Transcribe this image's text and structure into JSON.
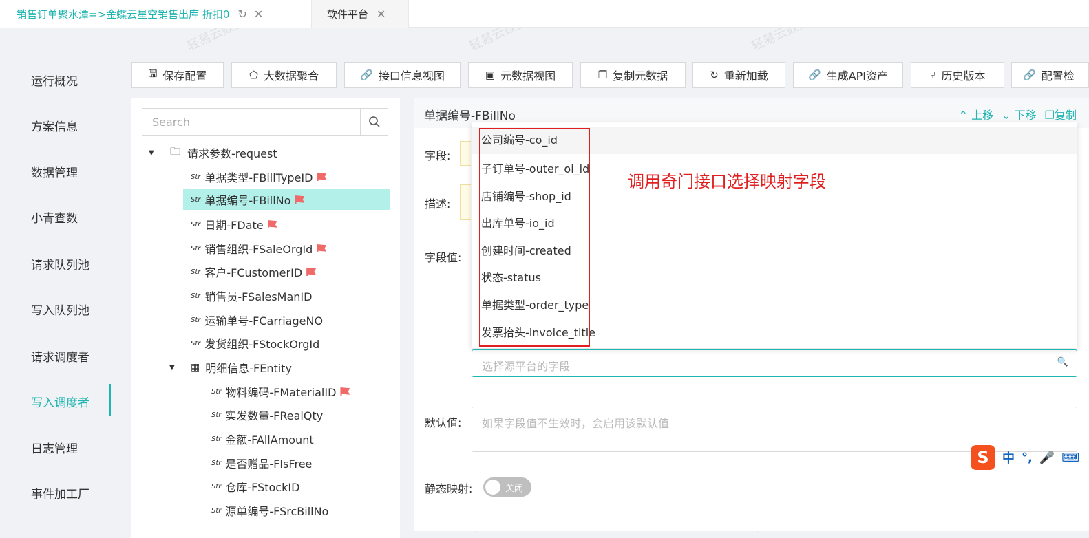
{
  "tabs": [
    {
      "label": "销售订单聚水潭=>金蝶云星空销售出库 折扣0",
      "active": true
    },
    {
      "label": "软件平台",
      "active": false
    }
  ],
  "nav": {
    "items": [
      "运行概况",
      "方案信息",
      "数据管理",
      "小青查数",
      "请求队列池",
      "写入队列池",
      "请求调度者",
      "写入调度者",
      "日志管理",
      "事件加工厂"
    ],
    "active": "写入调度者"
  },
  "toolbar": {
    "buttons": [
      "保存配置",
      "大数据聚合",
      "接口信息视图",
      "元数据视图",
      "复制元数据",
      "重新加载",
      "生成API资产",
      "历史版本",
      "配置检"
    ]
  },
  "tree": {
    "search_placeholder": "Search",
    "root": "请求参数-request",
    "fields": [
      {
        "label": "单据类型-FBillTypeID",
        "flag": true
      },
      {
        "label": "单据编号-FBillNo",
        "flag": true,
        "selected": true
      },
      {
        "label": "日期-FDate",
        "flag": true
      },
      {
        "label": "销售组织-FSaleOrgId",
        "flag": true
      },
      {
        "label": "客户-FCustomerID",
        "flag": true
      },
      {
        "label": "销售员-FSalesManID",
        "flag": false
      },
      {
        "label": "运输单号-FCarriageNO",
        "flag": false
      },
      {
        "label": "发货组织-FStockOrgId",
        "flag": false
      }
    ],
    "entity": "明细信息-FEntity",
    "entity_fields": [
      {
        "label": "物料编码-FMaterialID",
        "flag": true
      },
      {
        "label": "实发数量-FRealQty",
        "flag": false
      },
      {
        "label": "金额-FAllAmount",
        "flag": false
      },
      {
        "label": "是否赠品-FIsFree",
        "flag": false
      },
      {
        "label": "仓库-FStockID",
        "flag": false
      },
      {
        "label": "源单编号-FSrcBillNo",
        "flag": false
      }
    ],
    "str_tag": "Str"
  },
  "detail": {
    "title": "单据编号-FBillNo",
    "actions": [
      "上移",
      "下移",
      "复制"
    ],
    "labels": {
      "field": "字段:",
      "desc": "描述:",
      "value": "字段值:",
      "default": "默认值:",
      "static": "静态映射:"
    },
    "select_placeholder": "选择源平台的字段",
    "default_placeholder": "如果字段值不生效时，会启用该默认值",
    "toggle_label": "关闭"
  },
  "dropdown": {
    "options": [
      "公司编号-co_id",
      "子订单号-outer_oi_id",
      "店铺编号-shop_id",
      "出库单号-io_id",
      "创建时间-created",
      "状态-status",
      "单据类型-order_type",
      "发票抬头-invoice_title"
    ]
  },
  "annotation": "调用奇门接口选择映射字段",
  "ime": {
    "lang": "中"
  },
  "watermark": "轻易云数据集成平台"
}
